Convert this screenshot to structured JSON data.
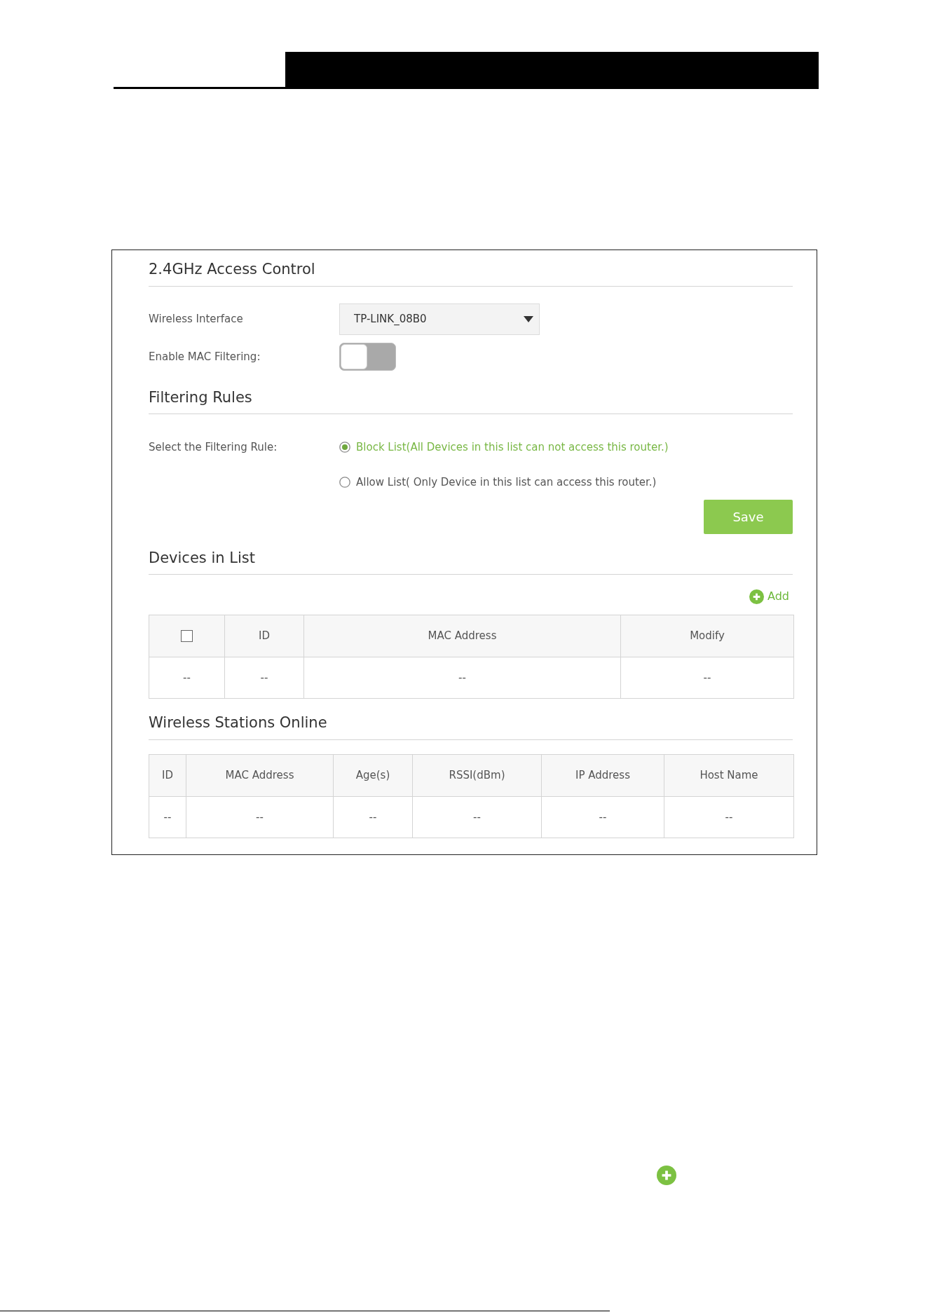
{
  "access_control": {
    "title": "2.4GHz Access Control",
    "wireless_interface": {
      "label": "Wireless Interface",
      "value": "TP-LINK_08B0"
    },
    "mac_filtering": {
      "label": "Enable MAC Filtering:",
      "on": false
    }
  },
  "filtering_rules": {
    "title": "Filtering Rules",
    "label": "Select the Filtering Rule:",
    "options": [
      {
        "label": "Block List(All Devices in this list can not access this router.)",
        "selected": true
      },
      {
        "label": "Allow List( Only Device in this list can access this router.)",
        "selected": false
      }
    ],
    "save_button": "Save"
  },
  "devices_in_list": {
    "title": "Devices in List",
    "add_button": "Add",
    "columns": [
      {
        "kind": "checkbox",
        "checked": false
      },
      {
        "kind": "text",
        "label": "ID"
      },
      {
        "kind": "text",
        "label": "MAC Address"
      },
      {
        "kind": "text",
        "label": "Modify"
      }
    ],
    "rows": [
      [
        "--",
        "--",
        "--",
        "--"
      ]
    ]
  },
  "wireless_stations_online": {
    "title": "Wireless Stations Online",
    "columns": [
      "ID",
      "MAC Address",
      "Age(s)",
      "RSSI(dBm)",
      "IP Address",
      "Host Name"
    ],
    "rows": [
      [
        "--",
        "--",
        "--",
        "--",
        "--",
        "--"
      ]
    ]
  }
}
